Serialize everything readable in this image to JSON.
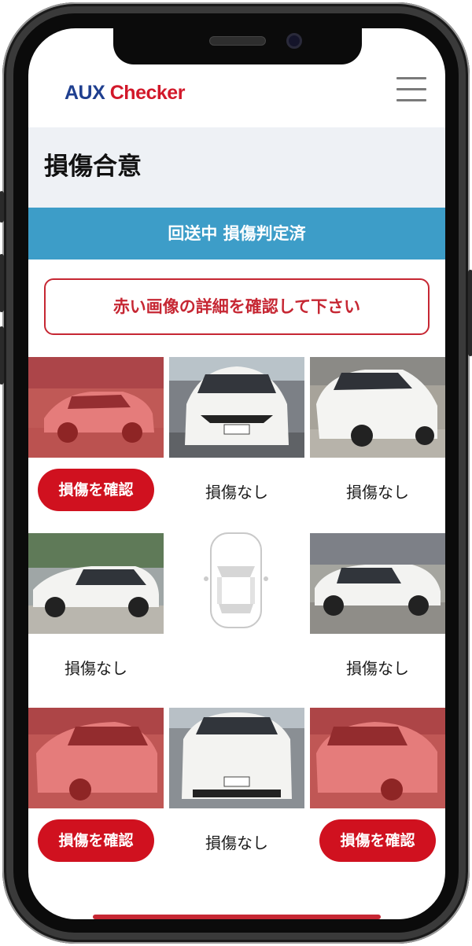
{
  "header": {
    "logo_aux": "AUX",
    "logo_checker": "Checker",
    "menu_icon": "hamburger-menu-icon"
  },
  "page": {
    "title": "損傷合意"
  },
  "status": {
    "label": "回送中 損傷判定済"
  },
  "notice": {
    "label": "赤い画像の詳細を確認して下さい"
  },
  "photos": [
    {
      "position": "front-left",
      "damaged": true,
      "label": "損傷を確認"
    },
    {
      "position": "front",
      "damaged": false,
      "label": "損傷なし"
    },
    {
      "position": "front-right",
      "damaged": false,
      "label": "損傷なし"
    },
    {
      "position": "left",
      "damaged": false,
      "label": "損傷なし"
    },
    {
      "position": "right",
      "damaged": false,
      "label": "損傷なし"
    },
    {
      "position": "rear-left",
      "damaged": true,
      "label": "損傷を確認"
    },
    {
      "position": "rear",
      "damaged": false,
      "label": "損傷なし"
    },
    {
      "position": "rear-right",
      "damaged": true,
      "label": "損傷を確認"
    }
  ],
  "colors": {
    "accent_red": "#d0111f",
    "status_blue": "#3d9dc8",
    "damage_overlay": "#dc2828"
  }
}
